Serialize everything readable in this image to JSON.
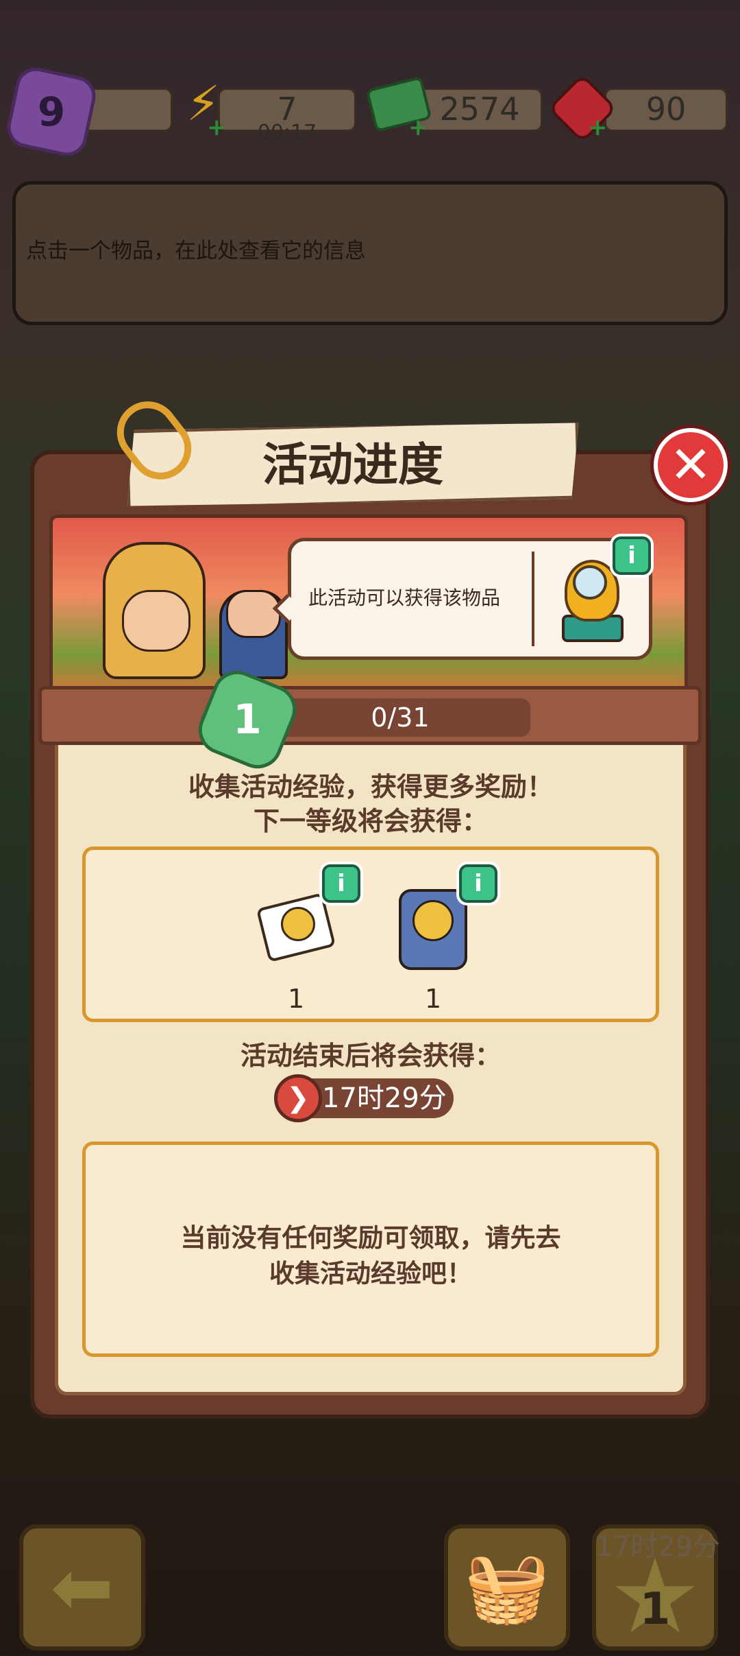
{
  "hud": {
    "level": "9",
    "energy_value": "7",
    "energy_timer": "00:17",
    "cash_value": "2574",
    "gems_value": "90",
    "icons": {
      "energy": "lightning-icon",
      "cash": "cash-icon",
      "gems": "ruby-icon",
      "plus": "plus-icon"
    }
  },
  "info_panel": {
    "text": "点击一个物品，在此处查看它的信息"
  },
  "dialog": {
    "title": "活动进度",
    "close_icon": "close-icon",
    "banner": {
      "tooltip_text": "此活动可以获得该物品"
    },
    "progress": {
      "level": "1",
      "text": "0/31",
      "fraction": 0.0
    },
    "desc_line1": "收集活动经验，获得更多奖励！",
    "desc_line2": "下一等级将会获得：",
    "rewards": [
      {
        "qty": "1",
        "icon": "photo-card-icon"
      },
      {
        "qty": "1",
        "icon": "sticker-pack-icon"
      }
    ],
    "after_end_text": "活动结束后将会获得：",
    "timer": "17时29分",
    "empty_line1": "当前没有任何奖励可领取，请先去",
    "empty_line2": "收集活动经验吧！"
  },
  "bottom_nav": {
    "back_icon": "arrow-left-icon",
    "basket_icon": "basket-icon",
    "event_timer": "17时29分",
    "event_count": "1",
    "star_icon": "star-icon"
  },
  "colors": {
    "accent_green": "#4ec48a",
    "close_red": "#e23a3a",
    "panel_bg": "#f4e4c6",
    "panel_border": "#d8962c",
    "text_brown": "#5a3a2a"
  }
}
